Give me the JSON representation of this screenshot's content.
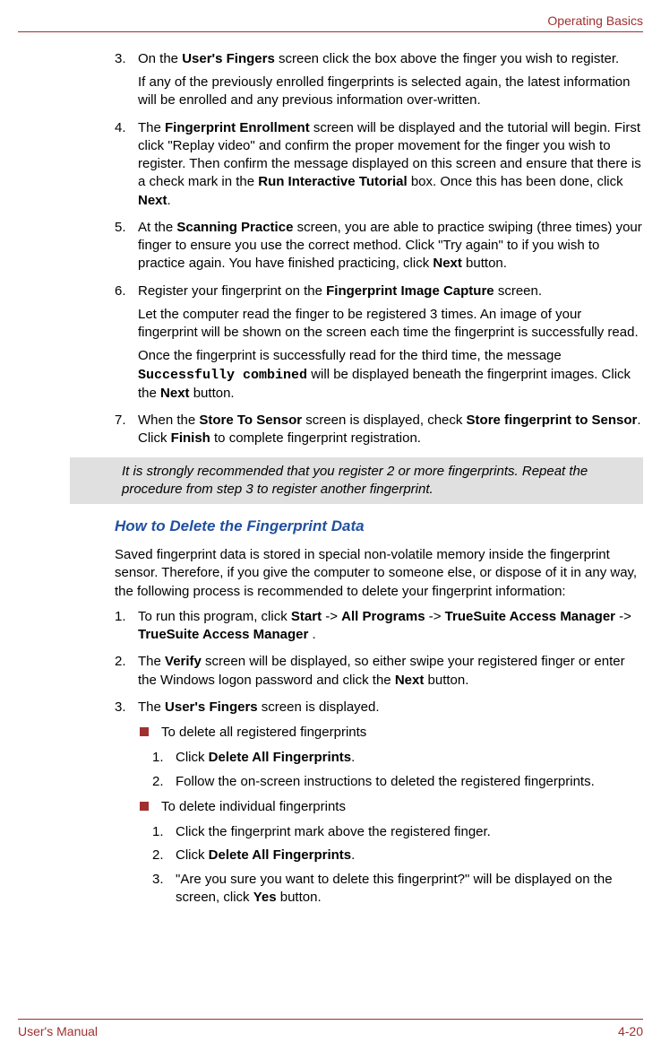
{
  "header": {
    "chapter": "Operating Basics"
  },
  "footer": {
    "left": "User's Manual",
    "right": "4-20"
  },
  "step3": {
    "n": "3.",
    "t1a": "On the ",
    "b1": "User's Fingers",
    "t1b": " screen click the box above the finger you wish to register.",
    "t2": "If any of the previously enrolled fingerprints is selected again, the latest information will be enrolled and any previous information over-written."
  },
  "step4": {
    "n": "4.",
    "a": "The ",
    "b1": "Fingerprint Enrollment",
    "c": " screen will be displayed and the tutorial will begin. First click \"Replay video\" and confirm the proper movement for the finger you wish to register. Then confirm the message displayed on this screen and ensure that there is a check mark in the ",
    "b2": "Run Interactive Tutorial",
    "d": " box. Once this has been done, click ",
    "b3": "Next",
    "e": "."
  },
  "step5": {
    "n": "5.",
    "a": "At the ",
    "b1": "Scanning Practice",
    "c": " screen, you are able to practice swiping (three times) your finger to ensure you use the correct method. Click \"Try again\" to if you wish to practice again. You have finished practicing, click ",
    "b2": "Next",
    "d": " button."
  },
  "step6": {
    "n": "6.",
    "a": "Register your fingerprint on the ",
    "b1": "Fingerprint Image Capture",
    "c": " screen.",
    "p2": "Let the computer read the finger to be registered 3 times. An image of your fingerprint will be shown on the screen each time the fingerprint is successfully read.",
    "p3a": "Once the fingerprint is successfully read for the third time, the message ",
    "p3m": "Successfully combined",
    "p3b": " will be displayed beneath the fingerprint images. Click the ",
    "p3bold": "Next",
    "p3c": " button."
  },
  "step7": {
    "n": "7.",
    "a": "When the ",
    "b1": "Store To Sensor",
    "c": " screen is displayed, check ",
    "b2": "Store fingerprint to Sensor",
    "d": ". Click ",
    "b3": "Finish",
    "e": " to complete fingerprint registration."
  },
  "note": "It is strongly recommended that you register 2 or more fingerprints. Repeat the procedure from step 3 to register another fingerprint.",
  "heading": "How to Delete the Fingerprint Data",
  "intro": "Saved fingerprint data is stored in special non-volatile memory inside the fingerprint sensor. Therefore, if you give the computer to someone else, or dispose of it in any way, the following process is recommended to delete your fingerprint information:",
  "d1": {
    "n": "1.",
    "a": "To run this program, click ",
    "b1": "Start",
    "s1": " -> ",
    "b2": "All Programs",
    "s2": " -> ",
    "b3": "TrueSuite Access Manager",
    "s3": " -> ",
    "b4": "TrueSuite Access Manager",
    "e": " ."
  },
  "d2": {
    "n": "2.",
    "a": "The ",
    "b1": "Verify",
    "c": " screen will be displayed, so either swipe your registered finger or enter the Windows logon password and click the ",
    "b2": "Next",
    "d": " button."
  },
  "d3": {
    "n": "3.",
    "a": "The ",
    "b1": "User's Fingers",
    "c": " screen is displayed."
  },
  "bullet1": "To delete all registered fingerprints",
  "sa1": {
    "n": "1.",
    "a": "Click ",
    "b": "Delete All Fingerprints",
    "c": "."
  },
  "sa2": {
    "n": "2.",
    "t": "Follow the on-screen instructions to deleted the registered fingerprints."
  },
  "bullet2": "To delete individual fingerprints",
  "sb1": {
    "n": "1.",
    "t": "Click the fingerprint mark above the registered finger."
  },
  "sb2": {
    "n": "2.",
    "a": "Click ",
    "b": "Delete All Fingerprints",
    "c": "."
  },
  "sb3": {
    "n": "3.",
    "a": "\"Are you sure you want to delete this fingerprint?\" will be displayed on the screen, click ",
    "b": "Yes",
    "c": " button."
  }
}
